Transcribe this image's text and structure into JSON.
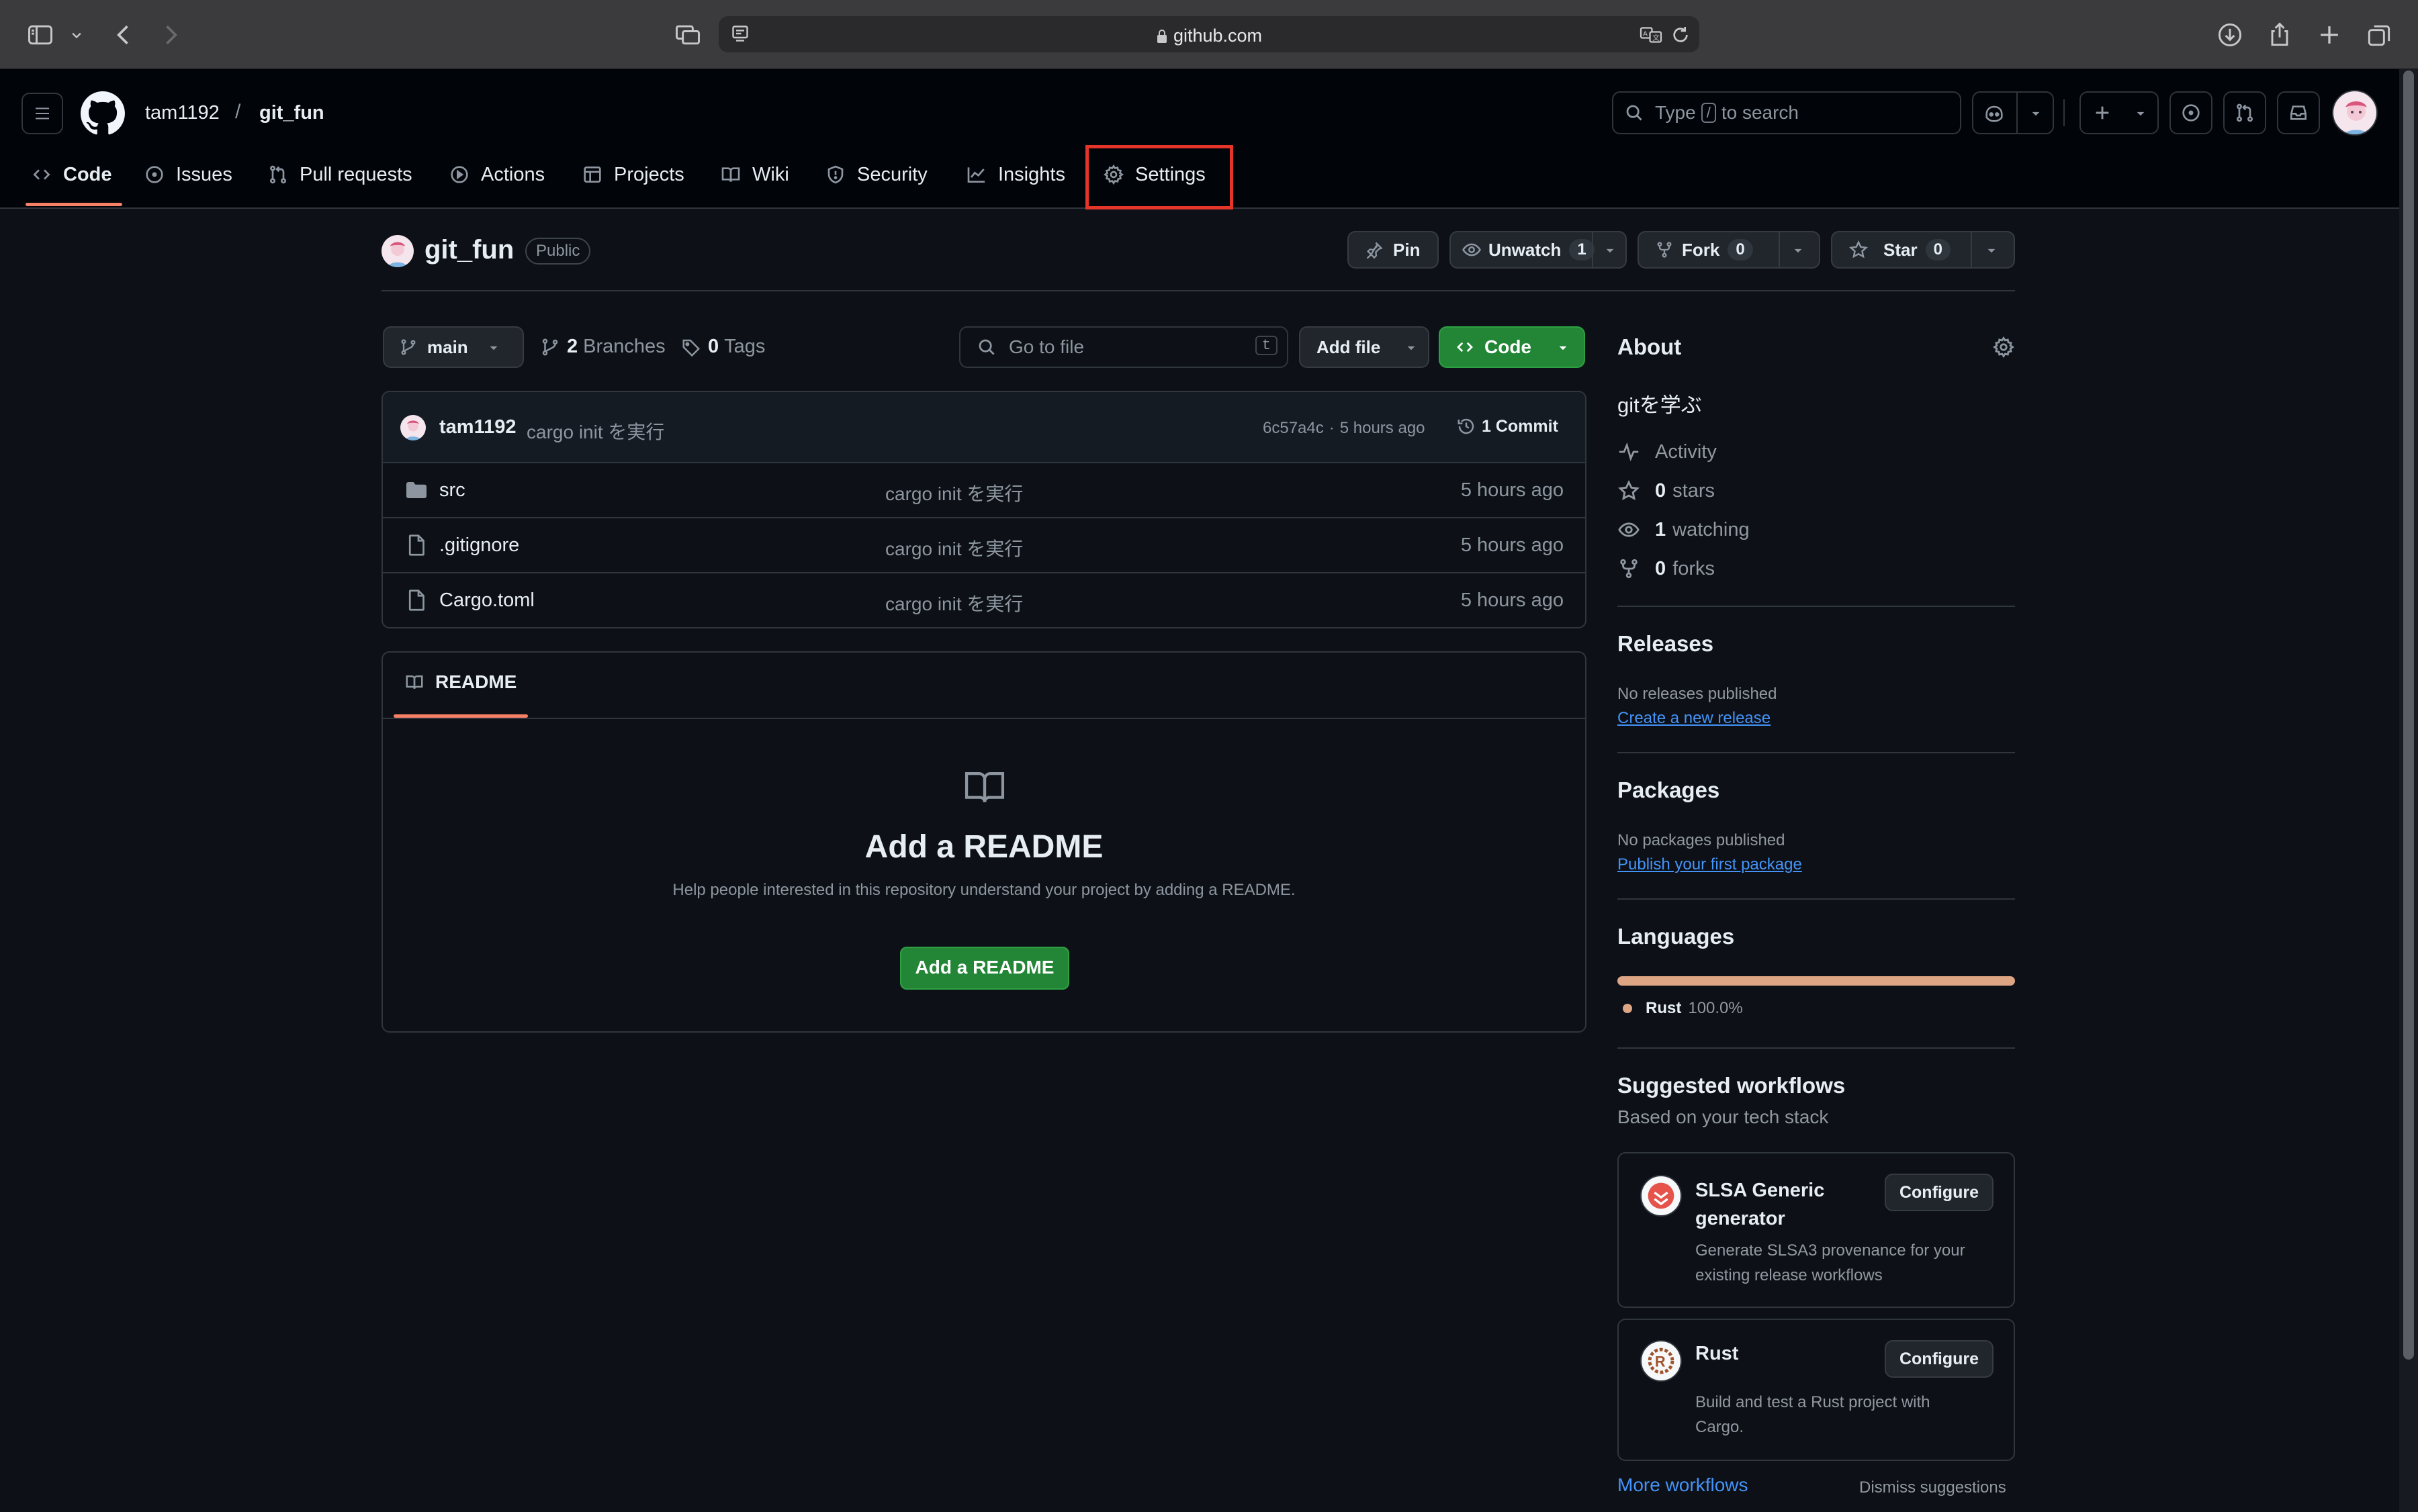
{
  "browser": {
    "url": "github.com"
  },
  "header": {
    "owner": "tam1192",
    "separator": "/",
    "repo": "git_fun",
    "search_prefix": "Type",
    "search_key": "/",
    "search_suffix": "to search"
  },
  "nav_tabs": [
    {
      "label": "Code",
      "icon": "code-icon"
    },
    {
      "label": "Issues",
      "icon": "issue-opened-icon"
    },
    {
      "label": "Pull requests",
      "icon": "git-pull-request-icon"
    },
    {
      "label": "Actions",
      "icon": "play-icon"
    },
    {
      "label": "Projects",
      "icon": "table-icon"
    },
    {
      "label": "Wiki",
      "icon": "book-icon"
    },
    {
      "label": "Security",
      "icon": "shield-icon"
    },
    {
      "label": "Insights",
      "icon": "graph-icon"
    },
    {
      "label": "Settings",
      "icon": "gear-icon"
    }
  ],
  "repo_head": {
    "name": "git_fun",
    "visibility": "Public",
    "pin": "Pin",
    "unwatch": "Unwatch",
    "watch_count": "1",
    "fork": "Fork",
    "fork_count": "0",
    "star": "Star",
    "star_count": "0"
  },
  "toolbar": {
    "branch": "main",
    "branches_count": "2",
    "branches_label": "Branches",
    "tags_count": "0",
    "tags_label": "Tags",
    "goto_placeholder": "Go to file",
    "goto_key": "t",
    "add_file": "Add file",
    "code": "Code"
  },
  "commit": {
    "author": "tam1192",
    "message": "cargo init を実行",
    "hash": "6c57a4c",
    "dot": "·",
    "time": "5 hours ago",
    "commits": "1 Commit"
  },
  "files": [
    {
      "name": "src",
      "type": "folder",
      "message": "cargo init を実行",
      "time": "5 hours ago"
    },
    {
      "name": ".gitignore",
      "type": "file",
      "message": "cargo init を実行",
      "time": "5 hours ago"
    },
    {
      "name": "Cargo.toml",
      "type": "file",
      "message": "cargo init を実行",
      "time": "5 hours ago"
    }
  ],
  "readme": {
    "tab": "README",
    "title": "Add a README",
    "description": "Help people interested in this repository understand your project by adding a README.",
    "button": "Add a README"
  },
  "about": {
    "heading": "About",
    "description": "gitを学ぶ",
    "activity": "Activity",
    "stars_count": "0",
    "stars_label": "stars",
    "watching_count": "1",
    "watching_label": "watching",
    "forks_count": "0",
    "forks_label": "forks"
  },
  "releases": {
    "heading": "Releases",
    "empty": "No releases published",
    "link": "Create a new release"
  },
  "packages": {
    "heading": "Packages",
    "empty": "No packages published",
    "link": "Publish your first package"
  },
  "languages": {
    "heading": "Languages",
    "items": [
      {
        "name": "Rust",
        "percent": "100.0%",
        "share": 1.0,
        "color": "#dea584"
      }
    ]
  },
  "workflows": {
    "heading": "Suggested workflows",
    "subheading": "Based on your tech stack",
    "items": [
      {
        "title_line1": "SLSA Generic",
        "title_line2": "generator",
        "desc_line1": "Generate SLSA3 provenance for your",
        "desc_line2": "existing release workflows",
        "button": "Configure"
      },
      {
        "title_line1": "Rust",
        "title_line2": "",
        "desc_line1": "Build and test a Rust project with",
        "desc_line2": "Cargo.",
        "button": "Configure"
      }
    ],
    "more": "More workflows",
    "dismiss": "Dismiss suggestions"
  },
  "colors": {
    "accent_green": "#238636",
    "link_blue": "#4493f8",
    "active_tab_underline": "#f78166",
    "highlight_box": "#e5342a"
  }
}
